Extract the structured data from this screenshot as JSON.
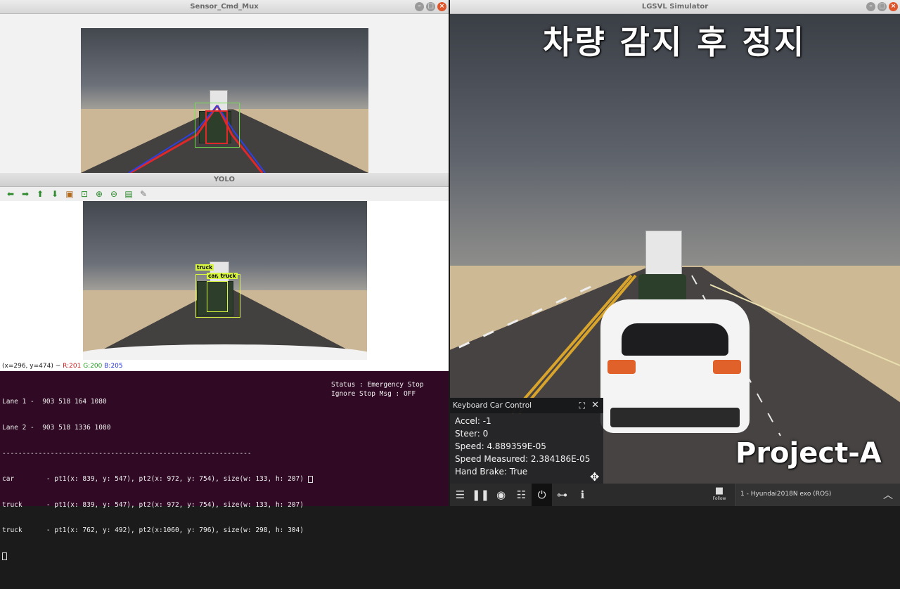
{
  "windows": {
    "sensor": {
      "title": "Sensor_Cmd_Mux"
    },
    "yolo": {
      "title": "YOLO"
    },
    "sim": {
      "title": "LGSVL Simulator"
    }
  },
  "yolo": {
    "status_coords": "(x=296, y=474) ~",
    "status_r": "R:201",
    "status_g": "G:200",
    "status_b": "B:205",
    "labels": [
      "truck",
      "car, truck"
    ],
    "toolbar_icons": [
      "arrow-left-icon",
      "arrow-right-icon",
      "arrow-up-icon",
      "arrow-down-icon",
      "image-icon",
      "crop-icon",
      "zoom-in-icon",
      "zoom-out-icon",
      "save-icon",
      "properties-icon"
    ]
  },
  "terminal": {
    "lines": [
      "Lane 1 -  903 518 164 1080",
      "Lane 2 -  903 518 1336 1080",
      "--------------------------------------------------------------",
      "car        - pt1(x: 839, y: 547), pt2(x: 972, y: 754), size(w: 133, h: 207)",
      "truck      - pt1(x: 839, y: 547), pt2(x: 972, y: 754), size(w: 133, h: 207)",
      "truck      - pt1(x: 762, y: 492), pt2(x:1060, y: 796), size(w: 298, h: 304)"
    ],
    "status_label": "Status : Emergency Stop",
    "ignore_label": "Ignore Stop Msg : OFF"
  },
  "overlay": {
    "korean_title": "차량 감지 후 정지",
    "project": "Project-A"
  },
  "keyboard_panel": {
    "title": "Keyboard Car Control",
    "rows": [
      "Accel: -1",
      "Steer: 0",
      "Speed: 4.889359E-05",
      "Speed Measured: 2.384186E-05",
      "Hand Brake: True"
    ]
  },
  "bottom_bar": {
    "follow_label": "Follow",
    "vehicle": "1 - Hyundai2018N exo (ROS)",
    "icons": [
      "menu-icon",
      "pause-icon",
      "eye-icon",
      "sliders-icon",
      "plug-icon",
      "gamepad-icon",
      "info-icon"
    ]
  },
  "colors": {
    "terminal_bg": "#300a24",
    "close_btn": "#e0562c",
    "bbox_green": "#71e24f",
    "label_yellow": "#d8f542"
  }
}
